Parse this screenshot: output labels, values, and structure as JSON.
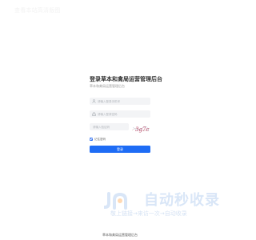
{
  "watermark": "查看本站高清版图",
  "login": {
    "title": "登录草本和禽局运营管理后台",
    "subtitle": "草本和禽局运营管理后台",
    "username_placeholder": "请输入登录手机号",
    "password_placeholder": "请输入登录密码",
    "captcha_placeholder": "请输入验证码",
    "captcha_text": "3g7c",
    "remember_label": "记住密码",
    "remember_checked": true,
    "submit_label": "登录"
  },
  "brand": {
    "name": "自动秒收录",
    "slogan": "敬上链接→来访一次→自动收录"
  },
  "footer": {
    "text": "草本和禽局运营管理后台"
  },
  "colors": {
    "primary": "#1e6cf5",
    "field_bg": "#f3f4f6",
    "brand_light": "#d9e6f7"
  }
}
